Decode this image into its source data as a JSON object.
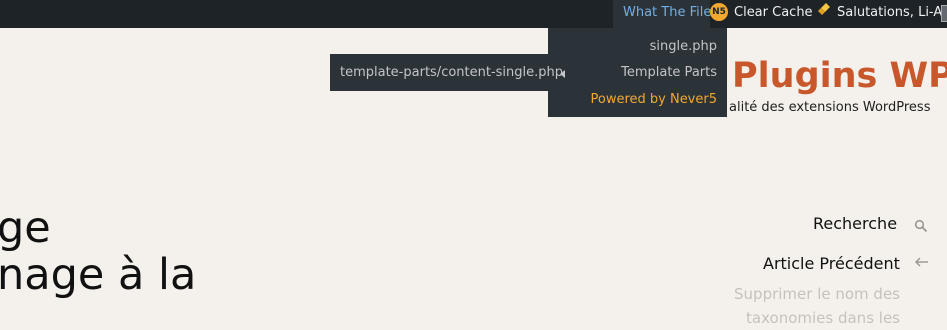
{
  "adminbar": {
    "what_the_file": "What The File",
    "cache_badge": "N5",
    "clear_cache": "Clear Cache",
    "greeting": "Salutations, Li-An"
  },
  "dropdown": {
    "items": [
      {
        "label": "single.php"
      },
      {
        "label": "Template Parts"
      },
      {
        "label": "Powered by Never5"
      }
    ],
    "submenu_item": "template-parts/content-single.php"
  },
  "site": {
    "title": "Plugins WP",
    "tagline": "alité des extensions WordPress"
  },
  "post": {
    "title_lines": [
      "ge",
      "nage à la"
    ]
  },
  "sidebar": {
    "search_label": "Recherche",
    "previous_label": "Article Précédent",
    "previous_link": "Supprimer le nom des taxonomies dans les"
  },
  "colors": {
    "adminbar_bg": "#1d2327",
    "dropdown_bg": "#2c3338",
    "link_blue": "#72aee6",
    "accent_orange": "#f0a830",
    "site_title": "#c8582c",
    "page_bg": "#f4f1ec"
  },
  "icons": [
    "cache-n5-icon",
    "broom-icon",
    "avatar-icon",
    "submenu-arrow-icon",
    "search-icon",
    "arrow-left-icon"
  ]
}
